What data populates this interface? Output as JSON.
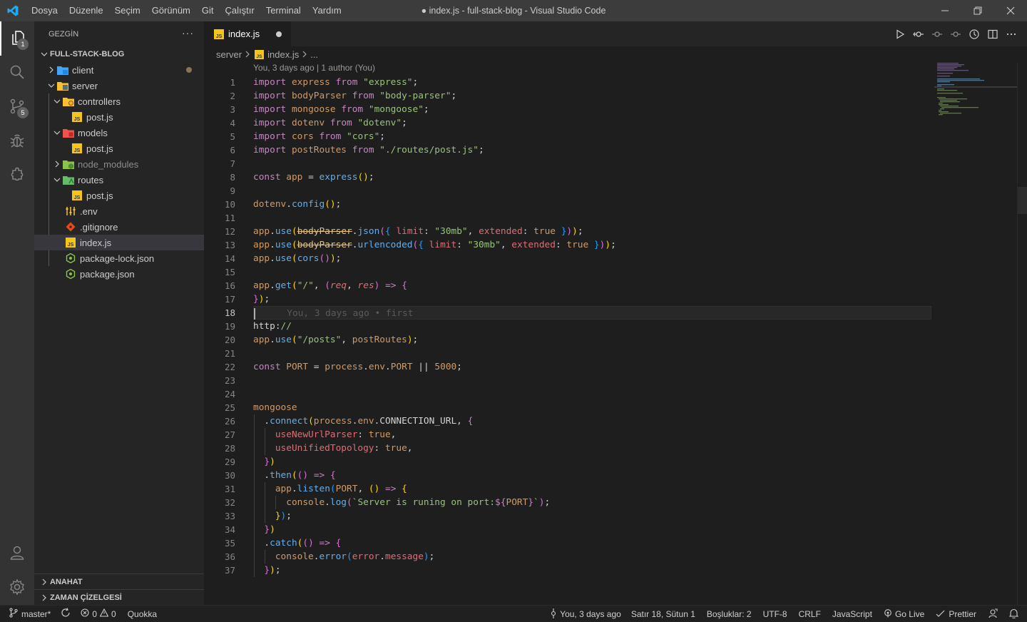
{
  "titlebar": {
    "menu": [
      "Dosya",
      "Düzenle",
      "Seçim",
      "Görünüm",
      "Git",
      "Çalıştır",
      "Terminal",
      "Yardım"
    ],
    "title": "● index.js - full-stack-blog - Visual Studio Code"
  },
  "activity": {
    "explorer_badge": "1",
    "scm_badge": "5"
  },
  "sidebar": {
    "header": "GEZGİN",
    "more": "···",
    "project": "FULL-STACK-BLOG",
    "tree": {
      "client": "client",
      "server": "server",
      "controllers": "controllers",
      "controllers_post": "post.js",
      "models": "models",
      "models_post": "post.js",
      "node_modules": "node_modules",
      "routes": "routes",
      "routes_post": "post.js",
      "env": ".env",
      "gitignore": ".gitignore",
      "index": "index.js",
      "package_lock": "package-lock.json",
      "package": "package.json"
    },
    "outline": "ANAHAT",
    "timeline": "ZAMAN ÇİZELGESİ"
  },
  "editor": {
    "tab_label": "index.js",
    "breadcrumb": [
      "server",
      "index.js",
      "..."
    ],
    "codelens": "You, 3 days ago | 1 author (You)",
    "blame": "You, 3 days ago • first",
    "line_numbers": [
      "1",
      "2",
      "3",
      "4",
      "5",
      "6",
      "7",
      "8",
      "9",
      "10",
      "11",
      "12",
      "13",
      "14",
      "15",
      "16",
      "17",
      "18",
      "19",
      "20",
      "21",
      "22",
      "23",
      "24",
      "25",
      "26",
      "27",
      "28",
      "29",
      "30",
      "31",
      "32",
      "33",
      "34",
      "35",
      "36",
      "37"
    ],
    "current_line": "18"
  },
  "statusbar": {
    "branch": "master*",
    "errors": "0",
    "warnings": "0",
    "quokka": "Quokka",
    "blame": "You, 3 days ago",
    "position": "Satır 18, Sütun 1",
    "spaces": "Boşluklar: 2",
    "encoding": "UTF-8",
    "eol": "CRLF",
    "language": "JavaScript",
    "golive": "Go Live",
    "prettier": "Prettier"
  },
  "colors": {
    "accent": "#007acc",
    "keyword": "#c586c0",
    "string": "#98c379",
    "identifier": "#d19a66",
    "function": "#61afef"
  }
}
